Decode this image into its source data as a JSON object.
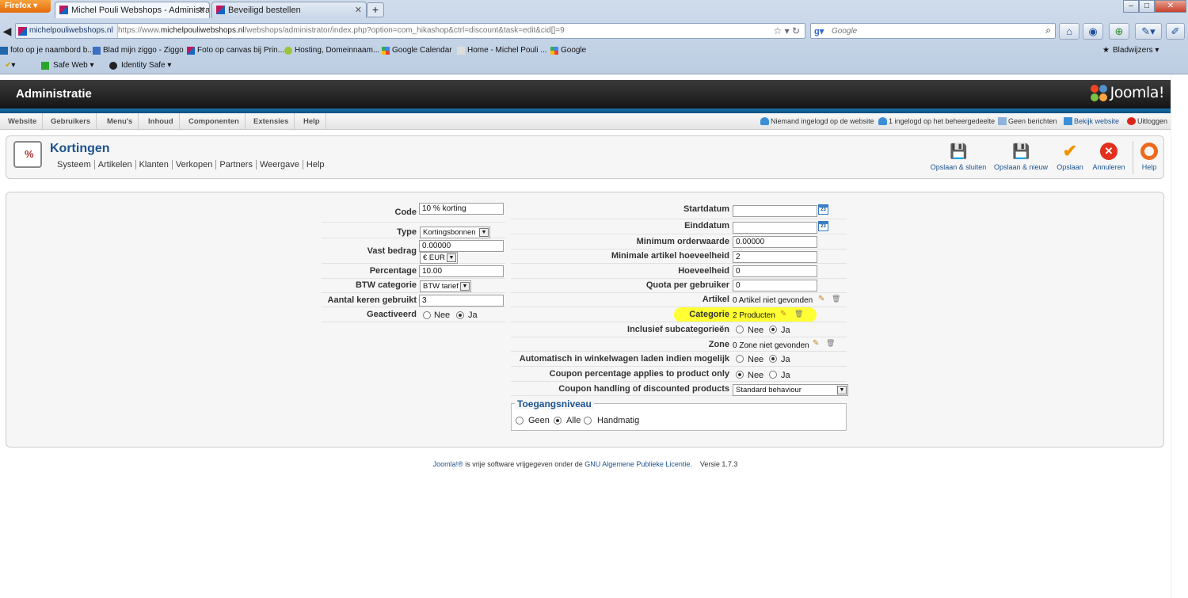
{
  "browser": {
    "app_button": "Firefox",
    "tabs": [
      {
        "label": "Michel Pouli Webshops - Administratie",
        "active": true
      },
      {
        "label": "Beveiligd bestellen",
        "active": false
      }
    ],
    "new_tab": "+",
    "site_identity": "michelpouliwebshops.nl",
    "url_prefix": "https://www.",
    "url_host": "michelpouliwebshops.nl",
    "url_path": "/webshops/administrator/index.php?option=com_hikashop&ctrl=discount&task=edit&cid[]=9",
    "search_placeholder": "Google",
    "bookmarks": [
      "foto op je naambord b...",
      "Blad mijn ziggo - Ziggo",
      "Foto op canvas bij Prin...",
      "Hosting, Domeinnaam...",
      "Google Calendar",
      "Home - Michel Pouli ...",
      "Google"
    ],
    "bookmarks_menu": "Bladwijzers",
    "toolbar3": [
      "Safe Web",
      "Identity Safe"
    ]
  },
  "admin": {
    "header_title": "Administratie",
    "logo_text": "Joomla!",
    "menu": [
      "Website",
      "Gebruikers",
      "Menu's",
      "Inhoud",
      "Componenten",
      "Extensies",
      "Help"
    ],
    "status": {
      "site_users": "Niemand ingelogd op de website",
      "admin_users": "1 ingelogd op het beheergedeelte",
      "messages": "Geen berichten",
      "view_site": "Bekijk website",
      "logout": "Uitloggen"
    },
    "page_title": "Kortingen",
    "submenu": [
      "Systeem",
      "Artikelen",
      "Klanten",
      "Verkopen",
      "Partners",
      "Weergave",
      "Help"
    ],
    "toolbar": {
      "save_close": "Opslaan & sluiten",
      "save_new": "Opslaan & nieuw",
      "save": "Opslaan",
      "cancel": "Annuleren",
      "help": "Help"
    }
  },
  "form": {
    "left": {
      "code_label": "Code",
      "code_value": "10 % korting",
      "type_label": "Type",
      "type_value": "Kortingsbonnen",
      "fixed_label": "Vast bedrag",
      "fixed_value": "0.00000",
      "currency_value": "€ EUR",
      "percentage_label": "Percentage",
      "percentage_value": "10.00",
      "tax_label": "BTW categorie",
      "tax_value": "BTW tarief",
      "used_label": "Aantal keren gebruikt",
      "used_value": "3",
      "active_label": "Geactiveerd",
      "no": "Nee",
      "yes": "Ja"
    },
    "right": {
      "start_label": "Startdatum",
      "start_value": "",
      "end_label": "Einddatum",
      "end_value": "",
      "cal_text": "23",
      "min_order_label": "Minimum orderwaarde",
      "min_order_value": "0.00000",
      "min_qty_label": "Minimale artikel hoeveelheid",
      "min_qty_value": "2",
      "qty_label": "Hoeveelheid",
      "qty_value": "0",
      "quota_label": "Quota per gebruiker",
      "quota_value": "0",
      "product_label": "Artikel",
      "product_value": "0 Artikel niet gevonden",
      "category_label": "Categorie",
      "category_value": "2 Producten",
      "subcat_label": "Inclusief subcategorieën",
      "zone_label": "Zone",
      "zone_value": "0 Zone niet gevonden",
      "autoload_label": "Automatisch in winkelwagen laden indien mogelijk",
      "coupon_pct_label": "Coupon percentage applies to product only",
      "coupon_handling_label": "Coupon handling of discounted products",
      "coupon_handling_value": "Standard behaviour",
      "no": "Nee",
      "yes": "Ja"
    },
    "access": {
      "legend": "Toegangsniveau",
      "none": "Geen",
      "all": "Alle",
      "manual": "Handmatig"
    }
  },
  "footer": {
    "joomla_link": "Joomla!®",
    "text1": " is vrije software vrijgegeven onder de ",
    "license_link": "GNU Algemene Publieke Licentie.",
    "version": "Versie 1.7.3"
  }
}
